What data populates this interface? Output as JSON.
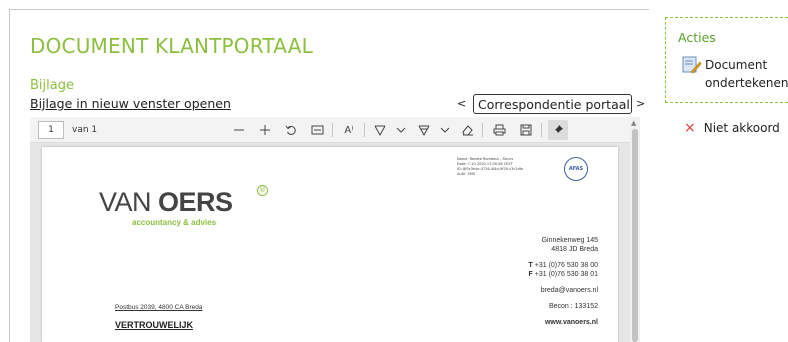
{
  "page": {
    "title": "DOCUMENT KLANTPORTAAL",
    "section_label": "Bijlage",
    "open_link": "Bijlage in nieuw venster openen"
  },
  "navigator": {
    "prev": "<",
    "next": ">",
    "selected_document": "Correspondentie portaal"
  },
  "viewer": {
    "page_number": "1",
    "page_of": "van 1",
    "toolbar_icons": [
      "minus-icon",
      "plus-icon",
      "rotate-icon",
      "fit-page-icon",
      "read-aloud-icon",
      "draw-icon",
      "chevron-down-icon",
      "highlight-icon",
      "chevron-down-icon",
      "eraser-icon",
      "print-icon",
      "save-icon",
      "pin-icon"
    ]
  },
  "document": {
    "signature_meta": [
      "Name: Renate Rombout - Sleurs",
      "Date: 7-10-2020 17:00:28 CEST",
      "ID: 8f0c3e4e-4726-4f4d-9f29-c3c2dfa",
      "Auth: SMS"
    ],
    "stamp_text": "AFAS",
    "logo_main": "VAN",
    "logo_bold": "OERS",
    "logo_mark": "®",
    "logo_sub": "accountancy & advies",
    "address_street": "Ginnekenweg 145",
    "address_city": "4818 JD  Breda",
    "phone": "+31 (0)76 530 38 00",
    "fax": "+31 (0)76 530 38 01",
    "phone_prefix": "T",
    "fax_prefix": "F",
    "email": "breda@vanoers.nl",
    "becon": "Becon : 133152",
    "website": "www.vanoers.nl",
    "postbus": "Postbus 2039, 4800 CA  Breda",
    "confidential": "VERTROUWELIJK"
  },
  "actions": {
    "title": "Acties",
    "sign_label": "Document ondertekenen",
    "reject_label": "Niet akkoord",
    "reject_icon": "×"
  },
  "colors": {
    "accent_green": "#8cbf3f",
    "reject_red": "#e03b3b"
  }
}
